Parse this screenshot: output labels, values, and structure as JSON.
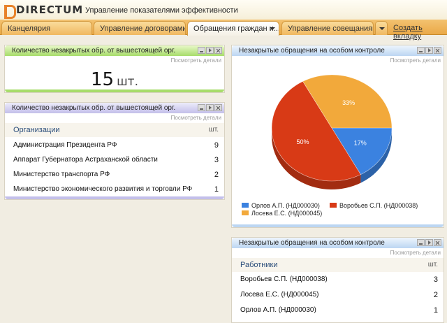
{
  "app": {
    "logo_text": "DIRECTUM",
    "title": "Управление показателями эффективности"
  },
  "tabs": [
    {
      "label": "Канцелярия"
    },
    {
      "label": "Управление договорами"
    },
    {
      "label": "Обращения граждан и...",
      "active": true
    },
    {
      "label": "Управление совещаниями"
    }
  ],
  "new_tab_label": "Создать вкладку",
  "details_label": "Посмотреть детали",
  "widgets": {
    "count_widget": {
      "title": "Количество незакрытых обр. от вышестоящей орг.",
      "value": "15",
      "unit": "шт."
    },
    "orgs_widget": {
      "title": "Количество незакрытых обр. от вышестоящей орг.",
      "col_name": "Организации",
      "col_value": "шт.",
      "rows": [
        {
          "name": "Администрация Президента РФ",
          "value": "9"
        },
        {
          "name": "Аппарат Губернатора Астраханской области",
          "value": "3"
        },
        {
          "name": "Министерство транспорта РФ",
          "value": "2"
        },
        {
          "name": "Министерство экономического развития и торговли РФ",
          "value": "1"
        }
      ]
    },
    "chart_widget": {
      "title": "Незакрытые обращения на особом контроле"
    },
    "workers_widget": {
      "title": "Незакрытые обращения на особом контроле",
      "col_name": "Работники",
      "col_value": "шт.",
      "rows": [
        {
          "name": "Воробьев С.П. (НД000038)",
          "value": "3"
        },
        {
          "name": "Лосева Е.С. (НД000045)",
          "value": "2"
        },
        {
          "name": "Орлов А.П. (НД000030)",
          "value": "1"
        }
      ]
    }
  },
  "chart_data": {
    "type": "pie",
    "slices": [
      {
        "name": "Орлов А.П. (НД000030)",
        "value": 17,
        "label": "17%",
        "color": "#3b82e0"
      },
      {
        "name": "Воробьев С.П. (НД000038)",
        "value": 50,
        "label": "50%",
        "color": "#d83a16"
      },
      {
        "name": "Лосева Е.С. (НД000045)",
        "value": 33,
        "label": "33%",
        "color": "#f2a93b"
      }
    ]
  },
  "colors": {
    "tab_bar": "#eaa948",
    "header_green": "#a7dc6a",
    "header_purple": "#c3bfea",
    "header_blue": "#bcd6f2"
  }
}
